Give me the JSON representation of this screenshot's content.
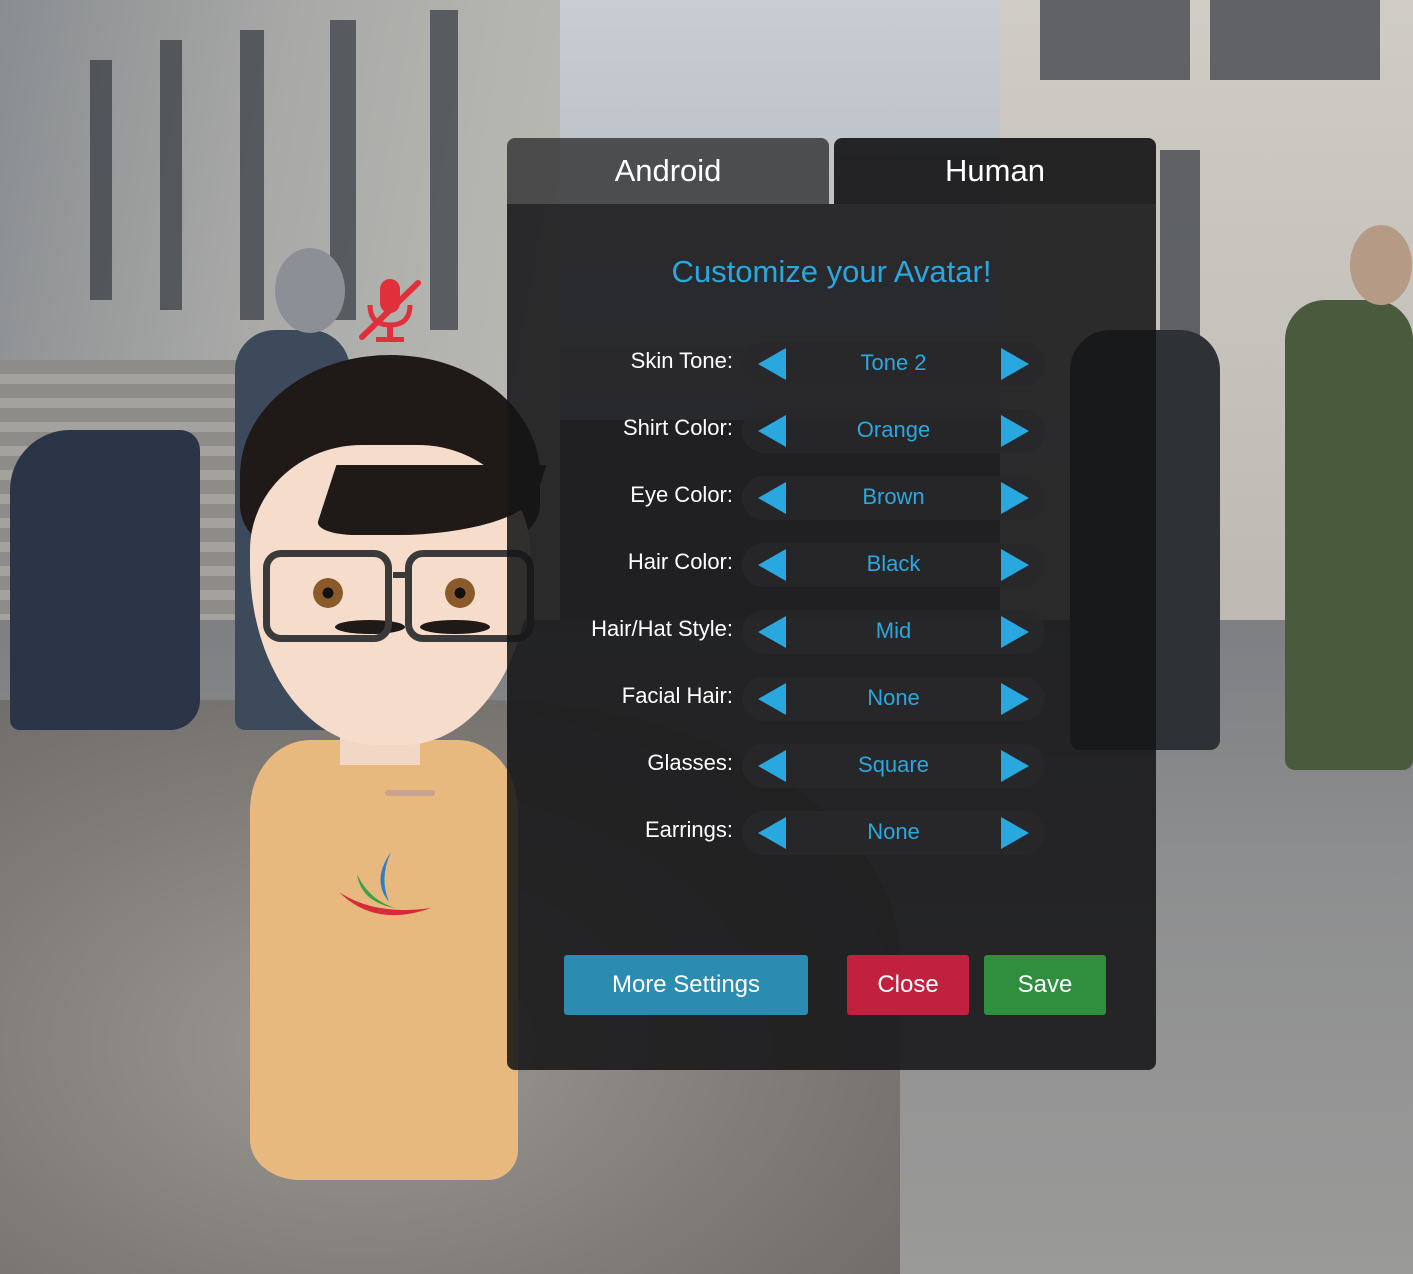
{
  "tabs": [
    {
      "label": "Android",
      "selected": false
    },
    {
      "label": "Human",
      "selected": true
    }
  ],
  "title": "Customize your Avatar!",
  "options": [
    {
      "label": "Skin Tone:",
      "value": "Tone 2"
    },
    {
      "label": "Shirt Color:",
      "value": "Orange"
    },
    {
      "label": "Eye Color:",
      "value": "Brown"
    },
    {
      "label": "Hair Color:",
      "value": "Black"
    },
    {
      "label": "Hair/Hat Style:",
      "value": "Mid"
    },
    {
      "label": "Facial Hair:",
      "value": "None"
    },
    {
      "label": "Glasses:",
      "value": "Square"
    },
    {
      "label": "Earrings:",
      "value": "None"
    }
  ],
  "buttons": {
    "more_settings": "More Settings",
    "close": "Close",
    "save": "Save"
  },
  "colors": {
    "accent": "#29a8e0",
    "more_settings": "#2b8bb0",
    "close": "#c2203f",
    "save": "#2f8f3f",
    "mic_off": "#e0303c"
  },
  "icons": {
    "mic_status": "microphone-muted-icon",
    "prev": "arrow-left-icon",
    "next": "arrow-right-icon"
  }
}
